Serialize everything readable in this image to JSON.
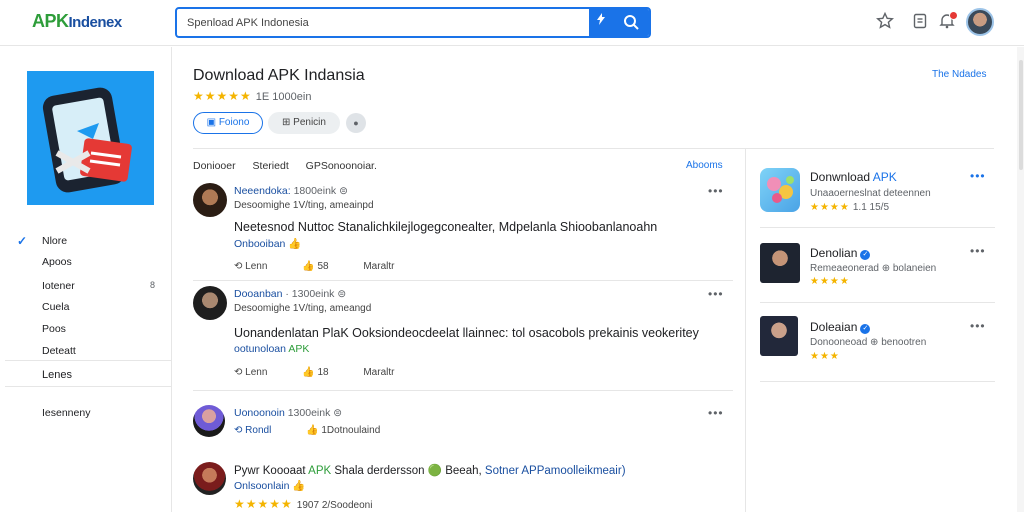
{
  "header": {
    "logo_apk": "APK",
    "logo_rest": "Indenex",
    "search_placeholder": "Spenload APK Indonesia"
  },
  "sidebar": {
    "items": [
      {
        "label": "Nlore",
        "selected": true
      },
      {
        "label": "Apoos"
      },
      {
        "label": "Iotener",
        "badge": "8"
      },
      {
        "label": "Cuela"
      },
      {
        "label": "Poos"
      },
      {
        "label": "Deteatt"
      },
      {
        "label": "Lenes"
      },
      {
        "label": "Iesenneny"
      }
    ]
  },
  "main": {
    "title": "Download APK Indansia",
    "rating_stars": "★★★★★",
    "rating_text": "1E 1000ein",
    "follow_label": "Foiono",
    "share_label": "Penicin",
    "top_link": "The Ndades",
    "tabs": [
      "Doniooer",
      "Steriedt",
      "GPSonoonoiar."
    ],
    "tab_link": "Abooms",
    "posts": [
      {
        "name": "Neeendoka:",
        "meta": "1800eink",
        "sub": "Desoomighe 1V/ting, ameainpd",
        "body": "Neetesnod Nuttoc Stanalichkilejlogegconealter, Mdpelanla Shioobanlanoahn",
        "tag": "Onbooiban 👍",
        "actions": [
          "Lenn",
          "58",
          "Maraltr"
        ]
      },
      {
        "name": "Dooanban",
        "meta": "· 1300eink",
        "sub": "Desoomighe 1V/ting, ameangd",
        "body": "Uonandenlatan PlaK Ooksiondeocdeelat llainnec: tol osacobols prekainis veokeritey",
        "tag": "ootunoloan",
        "tag_accent": "APK",
        "actions": [
          "Lenn",
          "18",
          "Maraltr"
        ]
      },
      {
        "name": "Uonoonoin",
        "meta": "1300eink",
        "sub": "",
        "body": "",
        "tag": "",
        "actions": [
          "Rondl",
          "1Dotnoulaind"
        ]
      },
      {
        "name": "",
        "meta": "",
        "sub": "",
        "body_pre": "Pywr Koooaat",
        "body_apk": "APK",
        "body_mid": "Shala derdersson 🟢 Beeah,",
        "body_blue": "Sotner APPamoolleikmeair)",
        "tag": "Onlsoonlain 👍",
        "rating_stars": "★★★★★",
        "rating_text": "1907 2/Soodeoni"
      }
    ]
  },
  "right": {
    "cards": [
      {
        "title": "Donwnload",
        "title_accent": "APK",
        "sub": "Unaaoerneslnat deteennen",
        "stars": "★★★★",
        "rating": "1.1 15/5"
      },
      {
        "title": "Denolian",
        "sub": "Remeaeonerad ⊕ bolaneien",
        "stars": "★★★★",
        "rating": ""
      },
      {
        "title": "Doleaian",
        "sub": "Donooneoad ⊕ benootren",
        "stars": "★★★",
        "rating": ""
      }
    ]
  },
  "colors": {
    "accent": "#1a73e8",
    "brand_green": "#2e9d3a",
    "star": "#f4b400"
  }
}
